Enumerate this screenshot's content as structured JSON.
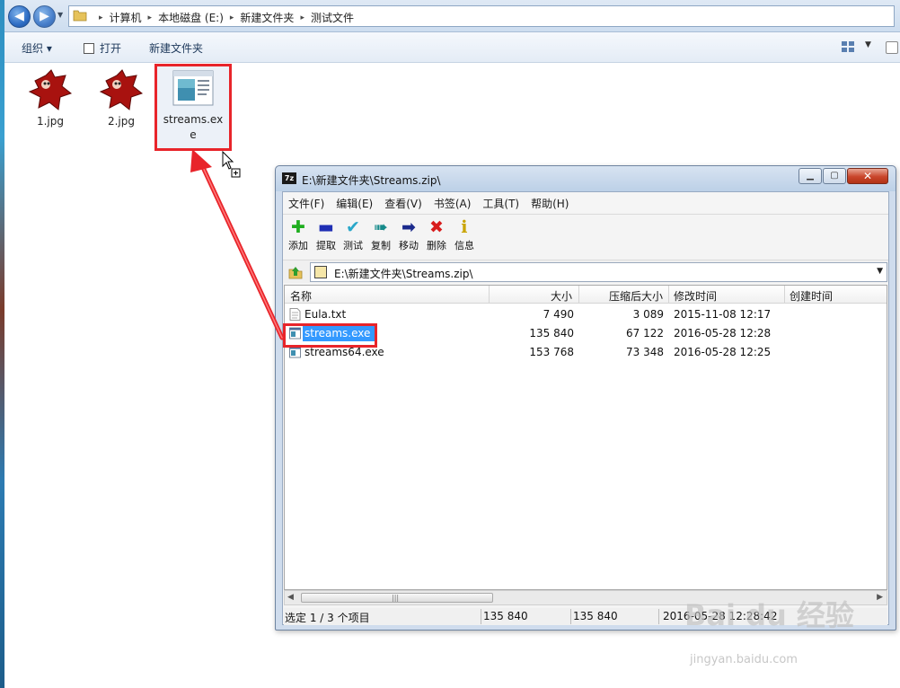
{
  "explorer": {
    "breadcrumbs": [
      "计算机",
      "本地磁盘 (E:)",
      "新建文件夹",
      "测试文件"
    ],
    "toolbar": {
      "organize": "组织 ▾",
      "open": "打开",
      "new_folder": "新建文件夹"
    },
    "files": [
      {
        "name": "1.jpg",
        "icon": "jpg-image-icon"
      },
      {
        "name": "2.jpg",
        "icon": "jpg-image-icon"
      },
      {
        "name": "streams.exe",
        "label_line1": "streams.ex",
        "label_line2": "e",
        "icon": "exe-window-icon",
        "selected": true
      }
    ]
  },
  "zip_window": {
    "title": "E:\\新建文件夹\\Streams.zip\\",
    "menu": [
      "文件(F)",
      "编辑(E)",
      "查看(V)",
      "书签(A)",
      "工具(T)",
      "帮助(H)"
    ],
    "tools": [
      {
        "label": "添加",
        "glyph": "✚",
        "color": "#1fae1f",
        "icon": "add-icon"
      },
      {
        "label": "提取",
        "glyph": "▬",
        "color": "#1f2fb4",
        "icon": "extract-icon"
      },
      {
        "label": "测试",
        "glyph": "✔",
        "color": "#2aa7c9",
        "icon": "test-icon"
      },
      {
        "label": "复制",
        "glyph": "➠",
        "color": "#168a8a",
        "icon": "copy-icon"
      },
      {
        "label": "移动",
        "glyph": "➡",
        "color": "#1b2a8c",
        "icon": "move-icon"
      },
      {
        "label": "删除",
        "glyph": "✖",
        "color": "#d81c1c",
        "icon": "delete-icon"
      },
      {
        "label": "信息",
        "glyph": "ℹ",
        "color": "#c9a400",
        "icon": "info-icon"
      }
    ],
    "path": "E:\\新建文件夹\\Streams.zip\\",
    "columns": [
      "名称",
      "大小",
      "压缩后大小",
      "修改时间",
      "创建时间"
    ],
    "rows": [
      {
        "name": "Eula.txt",
        "size": "7 490",
        "packed": "3 089",
        "modified": "2015-11-08 12:17",
        "created": "",
        "selected": false
      },
      {
        "name": "streams.exe",
        "size": "135 840",
        "packed": "67 122",
        "modified": "2016-05-28 12:28",
        "created": "",
        "selected": true
      },
      {
        "name": "streams64.exe",
        "size": "153 768",
        "packed": "73 348",
        "modified": "2016-05-28 12:25",
        "created": "",
        "selected": false
      }
    ],
    "status": {
      "selection": "选定 1 / 3 个项目",
      "size": "135 840",
      "packed": "135 840",
      "modified": "2016-05-28 12:28:42"
    }
  },
  "watermark": {
    "logo": "Bai du 经验",
    "url": "jingyan.baidu.com"
  },
  "colors": {
    "highlight_frame": "#e8242a",
    "selection_blue": "#3399ff"
  }
}
